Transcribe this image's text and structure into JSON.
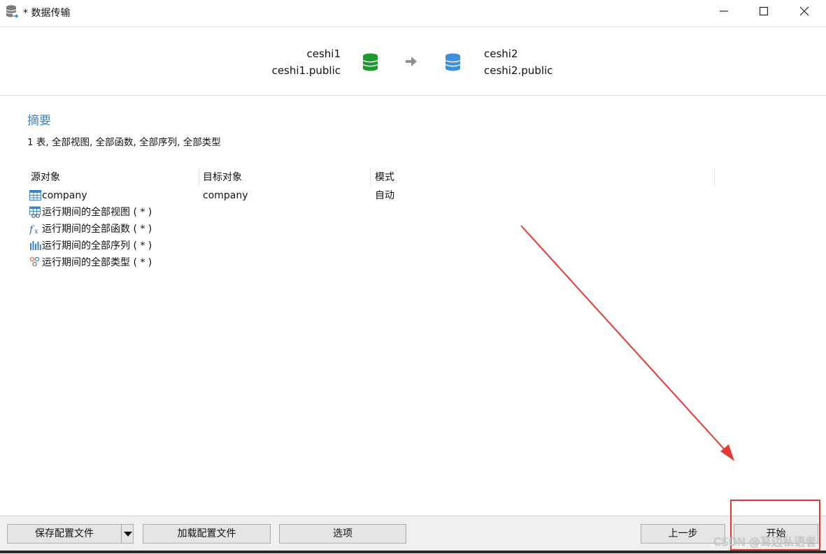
{
  "window": {
    "title": "* 数据传输",
    "minimize_label": "—",
    "maximize_label": "☐",
    "close_label": "✕"
  },
  "connection": {
    "source_name": "ceshi1",
    "source_schema": "ceshi1.public",
    "target_name": "ceshi2",
    "target_schema": "ceshi2.public",
    "source_icon_color": "#1a9b2a",
    "target_icon_color": "#3d8fe0"
  },
  "summary": {
    "title": "摘要",
    "text": "1 表, 全部视图, 全部函数, 全部序列, 全部类型"
  },
  "grid": {
    "headers": [
      "源对象",
      "目标对象",
      "模式"
    ],
    "rows": [
      {
        "icon": "table-icon",
        "source": "company",
        "target": "company",
        "mode": "自动"
      },
      {
        "icon": "view-icon",
        "source": "运行期间的全部视图 ( * )",
        "target": "",
        "mode": ""
      },
      {
        "icon": "function-icon",
        "source": "运行期间的全部函数 ( * )",
        "target": "",
        "mode": ""
      },
      {
        "icon": "sequence-icon",
        "source": "运行期间的全部序列 ( * )",
        "target": "",
        "mode": ""
      },
      {
        "icon": "type-icon",
        "source": "运行期间的全部类型 ( * )",
        "target": "",
        "mode": ""
      }
    ]
  },
  "footer": {
    "save_profile": "保存配置文件",
    "load_profile": "加载配置文件",
    "options": "选项",
    "back": "上一步",
    "start": "开始"
  },
  "watermark": "CSDN @耳边私语者",
  "colors": {
    "accent": "#3b86c6",
    "annotation": "#e53935"
  }
}
